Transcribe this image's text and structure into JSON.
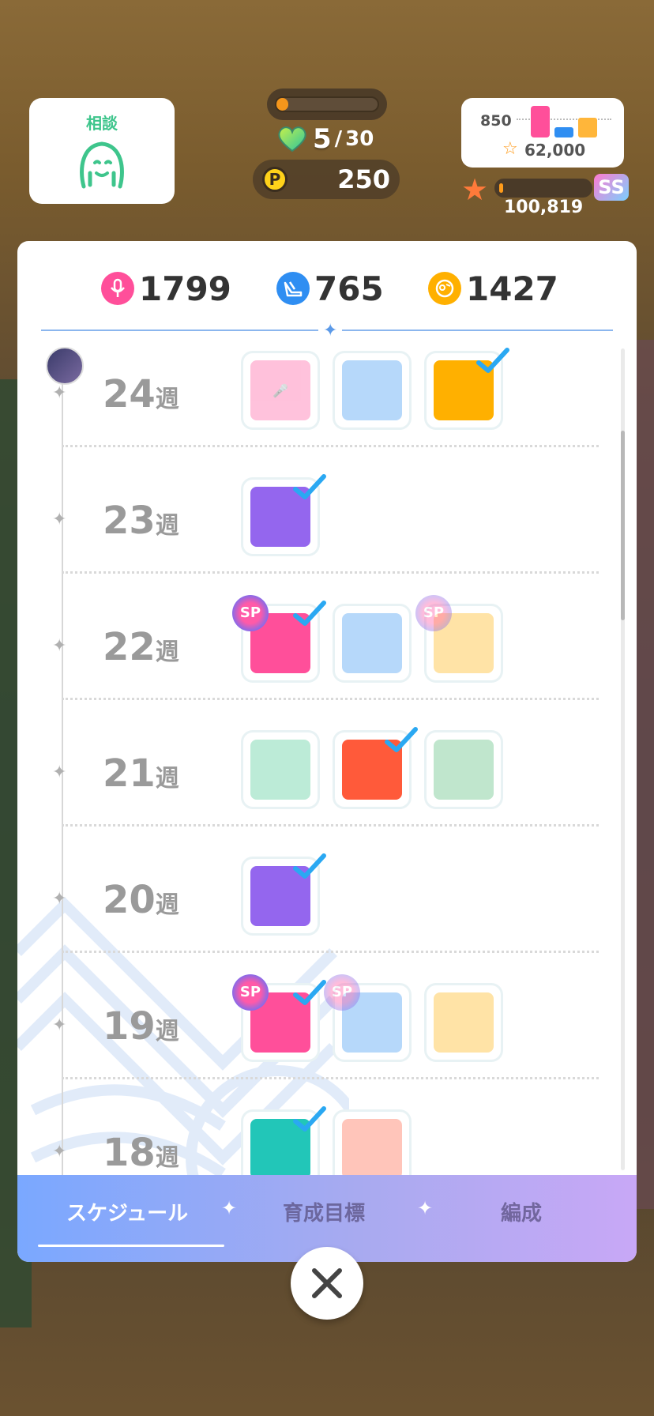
{
  "consult": {
    "label": "相談"
  },
  "stamina": {
    "fill_percent": 12
  },
  "hearts": {
    "current": "5",
    "slash": "/",
    "max": "30"
  },
  "points": {
    "coin": "P",
    "value": "250"
  },
  "fans": {
    "value": "850",
    "star_value": "62,000"
  },
  "rank": {
    "fill_percent": 4,
    "badge": "SS",
    "value": "100,819"
  },
  "stats": {
    "vocal": "1799",
    "dance": "765",
    "visual": "1427"
  },
  "weeks": [
    {
      "num": "24",
      "unit": "週"
    },
    {
      "num": "23",
      "unit": "週"
    },
    {
      "num": "22",
      "unit": "週"
    },
    {
      "num": "21",
      "unit": "週"
    },
    {
      "num": "20",
      "unit": "週"
    },
    {
      "num": "19",
      "unit": "週"
    },
    {
      "num": "18",
      "unit": "週"
    }
  ],
  "sp_label": "SP",
  "tabs": [
    "スケジュール",
    "育成目標",
    "編成"
  ],
  "colors": {
    "vocal": "#ff4f9a",
    "dance": "#2f8ef2",
    "visual": "#ffb000",
    "check": "#2aa8f2",
    "accent": "#5c9ae8"
  }
}
